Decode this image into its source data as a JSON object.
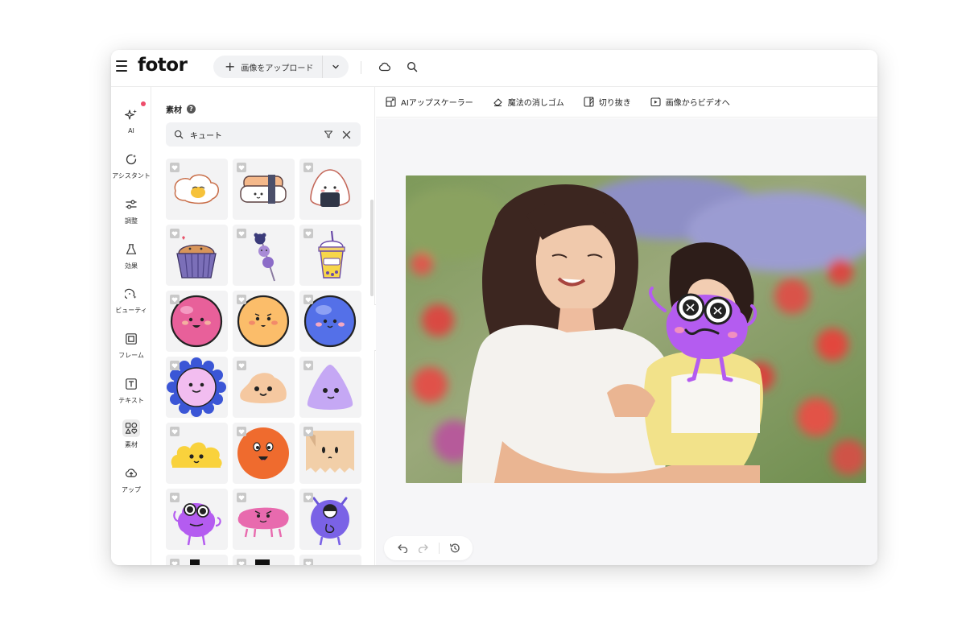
{
  "header": {
    "logo": "fotor",
    "upload_label": "画像をアップロード"
  },
  "rail": {
    "items": [
      {
        "label": "AI",
        "icon": "sparkle-icon"
      },
      {
        "label": "アシスタント",
        "icon": "assistant-icon"
      },
      {
        "label": "調整",
        "icon": "sliders-icon"
      },
      {
        "label": "効果",
        "icon": "flask-icon"
      },
      {
        "label": "ビューティ",
        "icon": "beauty-icon"
      },
      {
        "label": "フレーム",
        "icon": "frame-icon"
      },
      {
        "label": "テキスト",
        "icon": "text-icon"
      },
      {
        "label": "素材",
        "icon": "elements-icon"
      },
      {
        "label": "アップ",
        "icon": "cloud-upload-icon"
      }
    ],
    "active": "素材"
  },
  "panel": {
    "title": "素材",
    "help": "?",
    "search_value": "キュート"
  },
  "toolbar": {
    "tools": [
      {
        "label": "AIアップスケーラー",
        "icon": "upscale-icon"
      },
      {
        "label": "魔法の消しゴム",
        "icon": "eraser-icon"
      },
      {
        "label": "切り抜き",
        "icon": "cutout-icon"
      },
      {
        "label": "画像からビデオへ",
        "icon": "video-icon"
      }
    ]
  },
  "colors": {
    "accent_dot": "#ee4d6b",
    "sticker_purple": "#b45cf0",
    "canvas_bg": "#f6f6f8"
  },
  "stickers": [
    "fried-egg",
    "sushi",
    "onigiri",
    "cupcake",
    "dango",
    "boba-drink",
    "pink-ball",
    "orange-ball",
    "blue-ball",
    "lavender-flower",
    "peach-blob",
    "purple-triangle",
    "yellow-cloud",
    "orange-face",
    "beige-ghost",
    "purple-monster",
    "pink-pig",
    "violet-cyclops"
  ]
}
